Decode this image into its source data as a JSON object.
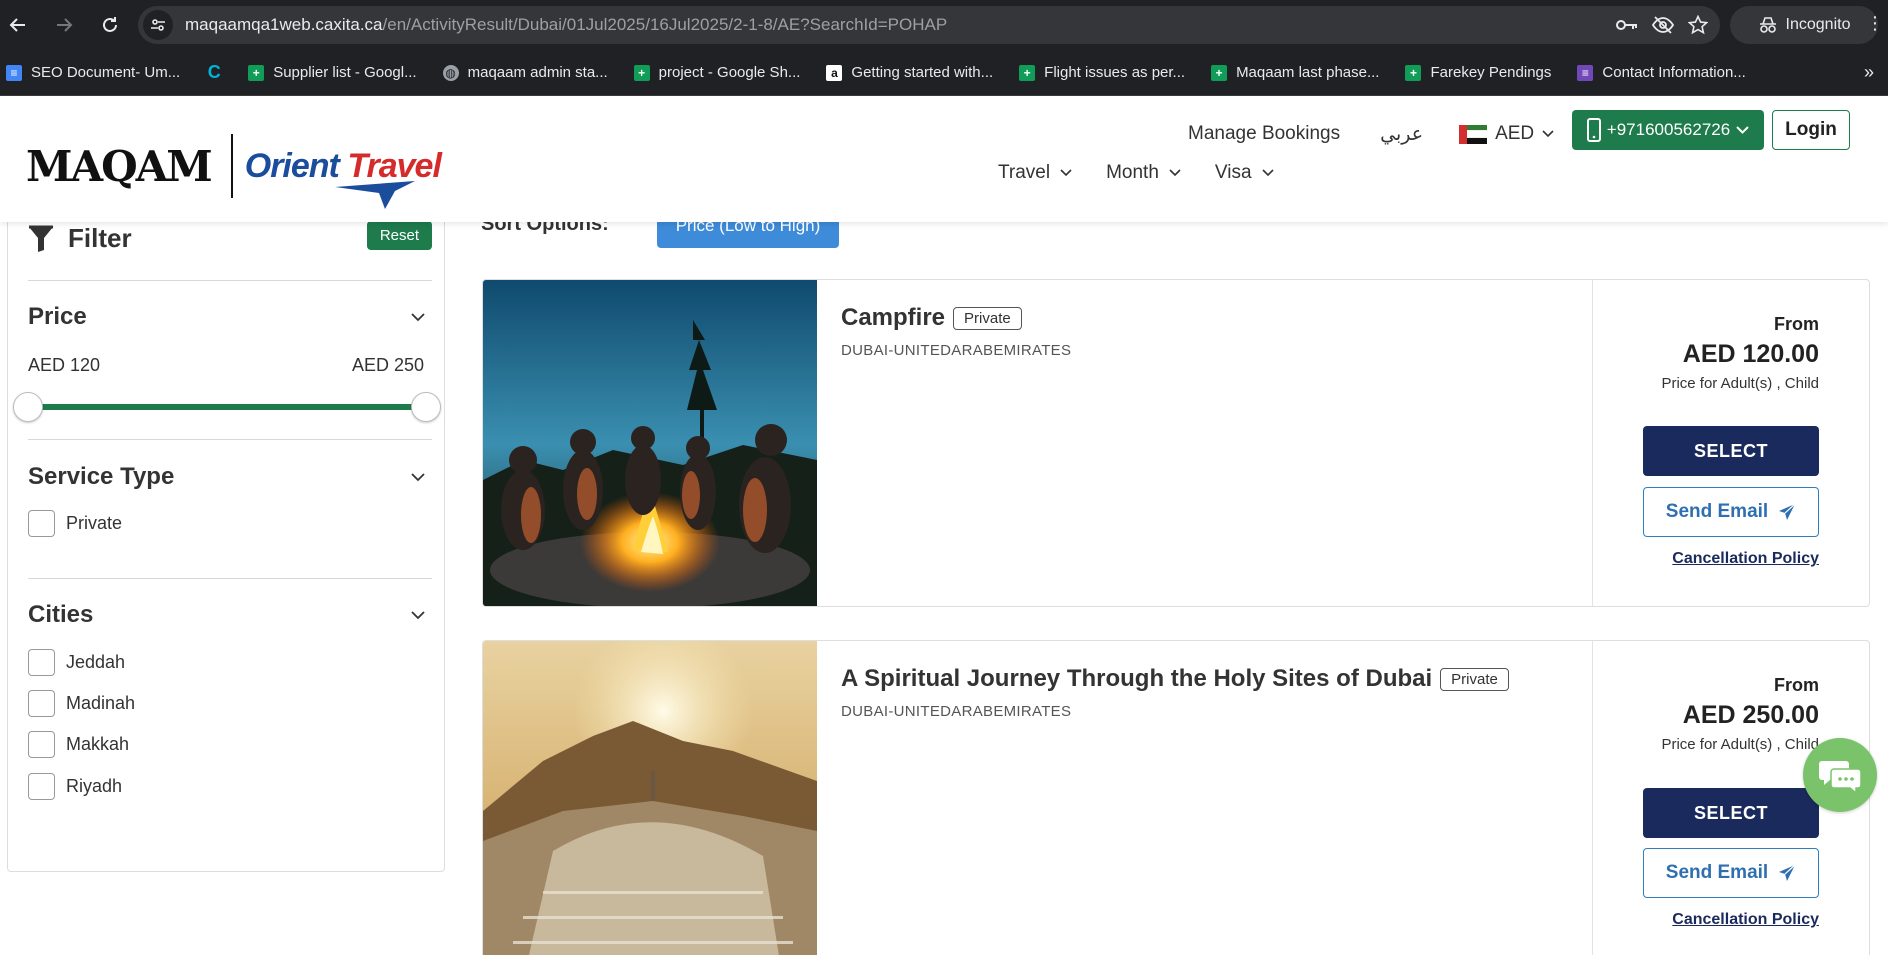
{
  "browser": {
    "url_host": "maqaamqa1web.caxita.ca",
    "url_path": "/en/ActivityResult/Dubai/01Jul2025/16Jul2025/2-1-8/AE?SearchId=POHAP",
    "incognito_label": "Incognito"
  },
  "bookmarks": [
    {
      "label": "SEO Document- Um...",
      "icon": "docs-icon",
      "color": "#4285f4"
    },
    {
      "label": "",
      "icon": "c-icon",
      "color": "#00b4d8"
    },
    {
      "label": "Supplier list - Googl...",
      "icon": "sheets-icon",
      "color": "#0f9d58"
    },
    {
      "label": "maqaam admin sta...",
      "icon": "globe-icon",
      "color": "#9aa0a6"
    },
    {
      "label": "project - Google Sh...",
      "icon": "sheets-icon",
      "color": "#0f9d58"
    },
    {
      "label": "Getting started with...",
      "icon": "amazon-icon",
      "color": "#ffffff"
    },
    {
      "label": "Flight issues as per...",
      "icon": "sheets-icon",
      "color": "#0f9d58"
    },
    {
      "label": "Maqaam last phase...",
      "icon": "sheets-icon",
      "color": "#0f9d58"
    },
    {
      "label": "Farekey Pendings",
      "icon": "sheets-icon",
      "color": "#0f9d58"
    },
    {
      "label": "Contact Information...",
      "icon": "forms-icon",
      "color": "#7248b9"
    }
  ],
  "header": {
    "logo_maqam": "MAQAM",
    "logo_orient_a": "Orient ",
    "logo_orient_b": "Travel",
    "manage_bookings": "Manage Bookings",
    "arabic": "عربي",
    "currency": "AED",
    "phone": "+971600562726",
    "login": "Login",
    "nav": [
      "Travel",
      "Month",
      "Visa"
    ]
  },
  "filter": {
    "title": "Filter",
    "reset": "Reset",
    "price_title": "Price",
    "price_min": "AED 120",
    "price_max": "AED 250",
    "service_title": "Service Type",
    "service_options": [
      "Private"
    ],
    "cities_title": "Cities",
    "cities": [
      "Jeddah",
      "Madinah",
      "Makkah",
      "Riyadh"
    ]
  },
  "sort": {
    "label": "Sort Options:",
    "value": "Price (Low to High)"
  },
  "results": [
    {
      "title": "Campfire",
      "badge": "Private",
      "location": "DUBAI-UNITEDARABEMIRATES",
      "from": "From",
      "price": "AED 120.00",
      "price_for": "Price for Adult(s) , Child",
      "select": "SELECT",
      "email": "Send Email",
      "cancel": "Cancellation Policy"
    },
    {
      "title": "A Spiritual Journey Through the Holy Sites of Dubai",
      "badge": "Private",
      "location": "DUBAI-UNITEDARABEMIRATES",
      "from": "From",
      "price": "AED 250.00",
      "price_for": "Price for Adult(s) , Child",
      "select": "SELECT",
      "email": "Send Email",
      "cancel": "Cancellation Policy"
    }
  ],
  "colors": {
    "brand_green": "#1e7b4c",
    "navy": "#1b2a5c",
    "sort_blue": "#3d8bd9",
    "chat_green": "#7ac36a"
  }
}
